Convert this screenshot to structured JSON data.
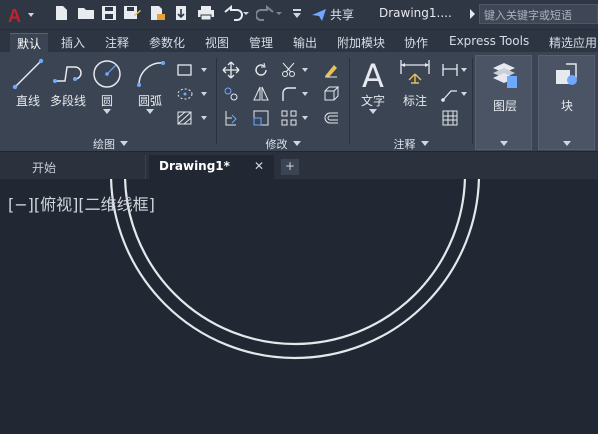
{
  "app": {
    "logo_letter": "A",
    "share_label": "共享",
    "doc_title": "Drawing1....",
    "search_placeholder": "键入关键字或短语"
  },
  "ribbon_tabs": [
    "默认",
    "插入",
    "注释",
    "参数化",
    "视图",
    "管理",
    "输出",
    "附加模块",
    "协作",
    "Express Tools",
    "精选应用"
  ],
  "draw_panel": {
    "tools": [
      "直线",
      "多段线",
      "圆",
      "圆弧"
    ],
    "footer": "绘图"
  },
  "modify_panel": {
    "footer": "修改"
  },
  "annotation_panel": {
    "tools": [
      "文字",
      "标注"
    ],
    "footer": "注释"
  },
  "layers_panel": {
    "label": "图层"
  },
  "block_panel": {
    "label": "块"
  },
  "doc_tabs": {
    "start": "开始",
    "active": "Drawing1*",
    "close": "✕",
    "new": "+"
  },
  "viewport": {
    "label": "[−][俯视][二维线框]"
  },
  "colors": {
    "accent": "#c8202a",
    "canvas": "#222833",
    "ribbon": "#3b4453",
    "share_icon": "#6fa8ff"
  }
}
